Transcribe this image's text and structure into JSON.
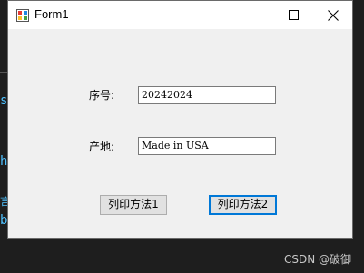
{
  "window": {
    "title": "Form1"
  },
  "form": {
    "serial_label": "序号:",
    "serial_value": "20242024",
    "origin_label": "产地:",
    "origin_value": "Made in USA",
    "button1_label": "列印方法1",
    "button2_label": "列印方法2"
  },
  "background": {
    "frag1": "s",
    "frag2": "h",
    "frag3": "言",
    "frag4": "b"
  },
  "watermark": "CSDN @破御"
}
